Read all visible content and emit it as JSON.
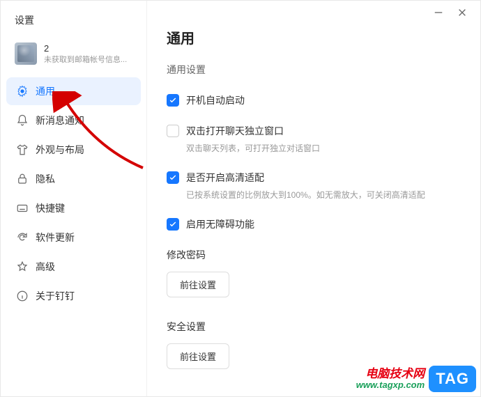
{
  "window": {
    "title": "设置"
  },
  "account": {
    "name": "2",
    "subtitle": "未获取到邮箱帐号信息..."
  },
  "sidebar": {
    "items": [
      {
        "label": "通用"
      },
      {
        "label": "新消息通知"
      },
      {
        "label": "外观与布局"
      },
      {
        "label": "隐私"
      },
      {
        "label": "快捷键"
      },
      {
        "label": "软件更新"
      },
      {
        "label": "高级"
      },
      {
        "label": "关于钉钉"
      }
    ]
  },
  "page": {
    "title": "通用",
    "section_general": "通用设置",
    "opts": {
      "autostart": {
        "label": "开机自动启动",
        "checked": true
      },
      "dblclick": {
        "label": "双击打开聊天独立窗口",
        "desc": "双击聊天列表，可打开独立对话窗口",
        "checked": false
      },
      "hidpi": {
        "label": "是否开启高清适配",
        "desc": "已按系统设置的比例放大到100%。如无需放大，可关闭高清适配",
        "checked": true
      },
      "a11y": {
        "label": "启用无障碍功能",
        "checked": true
      }
    },
    "change_password": {
      "heading": "修改密码",
      "button": "前往设置"
    },
    "security": {
      "heading": "安全设置",
      "button": "前往设置"
    }
  },
  "watermark": {
    "cn": "电脑技术网",
    "url": "www.tagxp.com",
    "tag": "TAG"
  }
}
